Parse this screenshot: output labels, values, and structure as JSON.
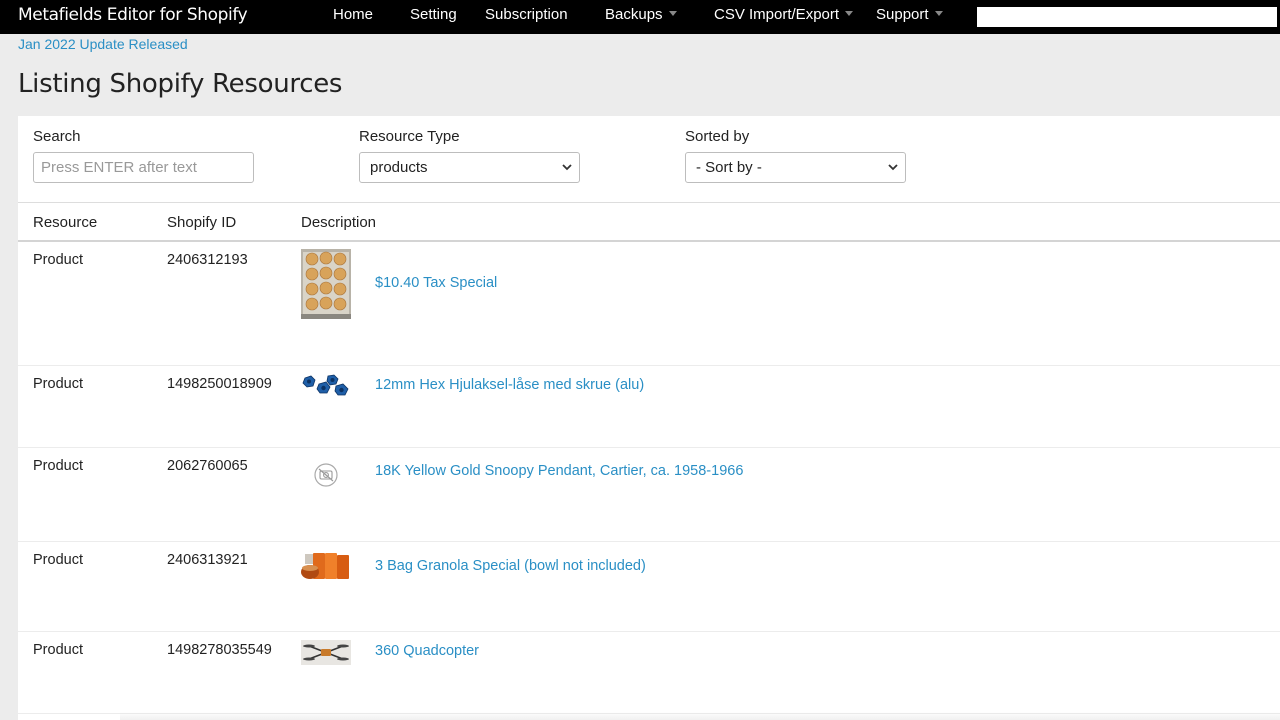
{
  "app": {
    "title": "Metafields Editor for Shopify"
  },
  "nav": [
    {
      "label": "Home",
      "dropdown": false
    },
    {
      "label": "Setting",
      "dropdown": false
    },
    {
      "label": "Subscription",
      "dropdown": false
    },
    {
      "label": "Backups",
      "dropdown": true
    },
    {
      "label": "CSV Import/Export",
      "dropdown": true
    },
    {
      "label": "Support",
      "dropdown": true
    }
  ],
  "nav_search": {
    "value": ""
  },
  "update_link": "Jan 2022 Update Released",
  "page_title": "Listing Shopify Resources",
  "filters": {
    "search_label": "Search",
    "search_placeholder": "Press ENTER after text",
    "resource_type_label": "Resource Type",
    "resource_type_value": "products",
    "sorted_by_label": "Sorted by",
    "sorted_by_value": "- Sort by -"
  },
  "table": {
    "headers": [
      "Resource",
      "Shopify ID",
      "Description"
    ],
    "rows": [
      {
        "resource": "Product",
        "id": "2406312193",
        "description": "$10.40 Tax Special",
        "image": "cookies-tray-image"
      },
      {
        "resource": "Product",
        "id": "1498250018909",
        "description": "12mm Hex Hjulaksel-låse med skrue (alu)",
        "image": "blue-hex-nuts-image"
      },
      {
        "resource": "Product",
        "id": "2062760065",
        "description": "18K Yellow Gold Snoopy Pendant, Cartier, ca. 1958-1966",
        "image": "no-image-icon"
      },
      {
        "resource": "Product",
        "id": "2406313921",
        "description": "3 Bag Granola Special (bowl not included)",
        "image": "granola-bags-image"
      },
      {
        "resource": "Product",
        "id": "1498278035549",
        "description": "360 Quadcopter",
        "image": "quadcopter-image"
      }
    ]
  },
  "colors": {
    "nav_bg": "#000000",
    "link": "#2a8fc5",
    "page_bg": "#ececec",
    "panel_bg": "#ffffff"
  }
}
